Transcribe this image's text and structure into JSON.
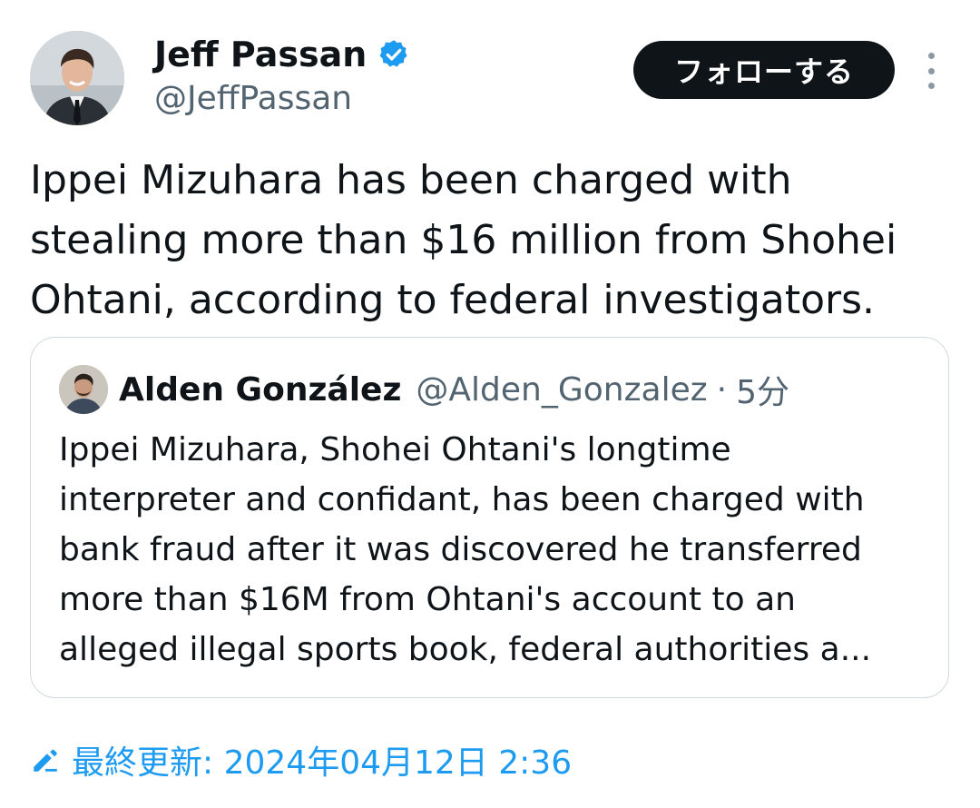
{
  "author": {
    "name": "Jeff Passan",
    "handle": "@JeffPassan",
    "verified": true
  },
  "follow_button": {
    "label": "フォローする"
  },
  "more_menu": {
    "icon": "more-vertical-icon"
  },
  "tweet": {
    "text": "Ippei Mizuhara has been charged with\nstealing more than $16 million from Shohei\nOhtani, according to federal investigators."
  },
  "quote": {
    "author_name": "Alden González",
    "author_handle": "@Alden_Gonzalez",
    "separator": "·",
    "time": "5分",
    "text": "Ippei Mizuhara, Shohei Ohtani's longtime\ninterpreter and confidant, has been charged with\nbank fraud after it was discovered he transferred\nmore than $16M from Ohtani's account to an\nalleged illegal sports book, federal authorities a..."
  },
  "edit_info": {
    "icon": "edit-pencil-icon",
    "label": "最終更新: 2024年04月12日 2:36"
  },
  "colors": {
    "text": "#0f1419",
    "secondary": "#536471",
    "accent": "#1d9bf0",
    "button_bg": "#0f1419",
    "border": "#cfd9de"
  }
}
